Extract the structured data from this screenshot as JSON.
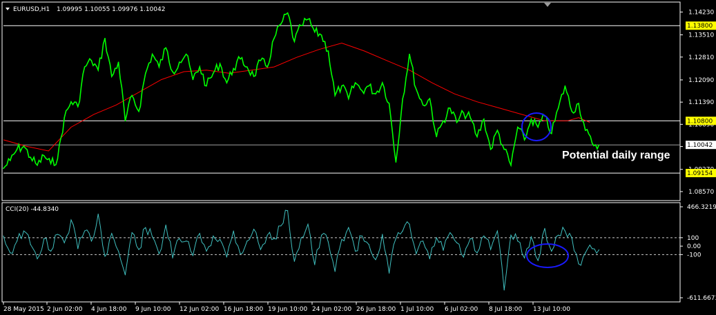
{
  "header": {
    "symbol_label": "EURUSD,H1",
    "ohlc_label": "1.09995 1.10055 1.09976 1.10042",
    "arrow_icon": "triangle-down-icon"
  },
  "annotation": "Potential daily range",
  "colors": {
    "background": "#000000",
    "price_line": "#00ff00",
    "moving_average": "#ff0000",
    "level_line": "#ffffff",
    "level_tag": "#ffff00",
    "cci_line": "#40c0c0",
    "ellipse": "#1a1aff",
    "grid": "#808080"
  },
  "chart_data": [
    {
      "type": "line",
      "title": "EURUSD,H1",
      "ylim": [
        1.0833,
        1.145
      ],
      "y_ticks": [
        "1.14230",
        "1.13510",
        "1.12810",
        "1.12090",
        "1.11390",
        "1.10690",
        "1.09990",
        "1.09270",
        "1.08570"
      ],
      "current_price": "1.10042",
      "levels": [
        {
          "value": 1.138,
          "label": "1.13800"
        },
        {
          "value": 1.108,
          "label": "1.10800"
        },
        {
          "value": 1.09154,
          "label": "1.09154"
        }
      ],
      "x_ticks": [
        "28 May 2015",
        "2 Jun 02:00",
        "4 Jun 18:00",
        "9 Jun 10:00",
        "12 Jun 02:00",
        "16 Jun 18:00",
        "19 Jun 10:00",
        "24 Jun 02:00",
        "26 Jun 18:00",
        "1 Jul 10:00",
        "6 Jul 02:00",
        "8 Jul 18:00",
        "13 Jul 10:00"
      ],
      "series": [
        {
          "x": [
            0,
            3,
            6,
            9,
            12,
            15,
            18,
            21,
            24,
            27,
            30,
            33,
            36,
            39,
            42,
            45,
            48,
            51,
            54,
            57,
            60,
            63,
            66,
            69,
            72,
            75,
            78,
            81,
            84,
            87,
            90,
            93,
            96,
            99,
            102,
            105,
            108,
            111,
            114,
            117,
            120,
            123,
            126,
            129,
            132,
            135,
            138,
            141,
            144,
            147,
            150,
            153,
            156,
            159,
            162,
            165,
            168,
            171,
            174,
            177,
            180,
            183,
            186,
            189,
            192,
            195,
            198,
            201,
            204,
            207,
            210,
            213,
            216,
            219,
            222,
            225,
            228,
            231,
            234,
            237,
            240,
            243,
            246,
            249,
            252,
            255,
            258,
            261,
            264
          ],
          "values": [
            1.093,
            1.0955,
            1.099,
            1.1,
            1.0965,
            1.094,
            1.097,
            1.0945,
            1.096,
            1.109,
            1.114,
            1.1125,
            1.125,
            1.127,
            1.124,
            1.134,
            1.122,
            1.1265,
            1.108,
            1.116,
            1.111,
            1.123,
            1.129,
            1.125,
            1.131,
            1.1235,
            1.1265,
            1.129,
            1.121,
            1.125,
            1.119,
            1.123,
            1.126,
            1.12,
            1.1245,
            1.1275,
            1.125,
            1.122,
            1.127,
            1.125,
            1.134,
            1.1385,
            1.142,
            1.133,
            1.138,
            1.14,
            1.136,
            1.135,
            1.13,
            1.116,
            1.119,
            1.115,
            1.12,
            1.1175,
            1.119,
            1.1165,
            1.12,
            1.1135,
            1.095,
            1.115,
            1.129,
            1.118,
            1.113,
            1.115,
            1.103,
            1.108,
            1.112,
            1.1075,
            1.1105,
            1.109,
            1.103,
            1.1085,
            1.099,
            1.105,
            1.099,
            1.094,
            1.106,
            1.102,
            1.1085,
            1.106,
            1.1095,
            1.104,
            1.112,
            1.119,
            1.111,
            1.1135,
            1.105,
            1.101,
            1.1004
          ]
        },
        {
          "x": [
            0,
            10,
            20,
            30,
            40,
            50,
            60,
            70,
            80,
            90,
            100,
            110,
            120,
            130,
            140,
            150,
            160,
            170,
            180,
            190,
            200,
            210,
            220,
            230,
            240,
            250,
            255,
            260
          ],
          "values": [
            1.102,
            1.1,
            1.0985,
            1.106,
            1.11,
            1.113,
            1.117,
            1.121,
            1.1235,
            1.124,
            1.123,
            1.124,
            1.125,
            1.128,
            1.1305,
            1.1325,
            1.13,
            1.127,
            1.124,
            1.12,
            1.1165,
            1.114,
            1.112,
            1.11,
            1.108,
            1.108,
            1.109,
            1.1075
          ]
        }
      ]
    },
    {
      "type": "line",
      "title": "CCI(20) -44.8340",
      "ylim": [
        -611.6673,
        466.3219
      ],
      "y_ticks": [
        "466.3219",
        "100",
        "0.00",
        "-100",
        "-611.6673"
      ],
      "levels": [
        100,
        -100
      ],
      "series": [
        {
          "x": [
            0,
            3,
            6,
            9,
            12,
            15,
            18,
            21,
            24,
            27,
            30,
            33,
            36,
            39,
            42,
            45,
            48,
            51,
            54,
            57,
            60,
            63,
            66,
            69,
            72,
            75,
            78,
            81,
            84,
            87,
            90,
            93,
            96,
            99,
            102,
            105,
            108,
            111,
            114,
            117,
            120,
            123,
            126,
            129,
            132,
            135,
            138,
            141,
            144,
            147,
            150,
            153,
            156,
            159,
            162,
            165,
            168,
            171,
            174,
            177,
            180,
            183,
            186,
            189,
            192,
            195,
            198,
            201,
            204,
            207,
            210,
            213,
            216,
            219,
            222,
            225,
            228,
            231,
            234,
            237,
            240,
            243,
            246,
            249,
            252,
            255,
            258,
            261,
            264
          ],
          "values": [
            120,
            -80,
            60,
            180,
            20,
            -150,
            90,
            -60,
            140,
            40,
            310,
            -30,
            180,
            60,
            380,
            -120,
            150,
            -60,
            -340,
            160,
            -40,
            220,
            110,
            -90,
            250,
            -140,
            90,
            60,
            -110,
            150,
            -60,
            120,
            80,
            -130,
            180,
            -90,
            60,
            200,
            -40,
            130,
            90,
            240,
            420,
            -180,
            100,
            260,
            -220,
            130,
            50,
            -300,
            80,
            220,
            -60,
            120,
            20,
            -160,
            140,
            -320,
            90,
            180,
            260,
            -90,
            60,
            -150,
            100,
            -50,
            160,
            40,
            -130,
            90,
            -80,
            120,
            -40,
            180,
            -520,
            130,
            60,
            -140,
            110,
            -170,
            210,
            -60,
            130,
            180,
            100,
            -210,
            -80,
            -30,
            -45
          ]
        }
      ]
    }
  ]
}
